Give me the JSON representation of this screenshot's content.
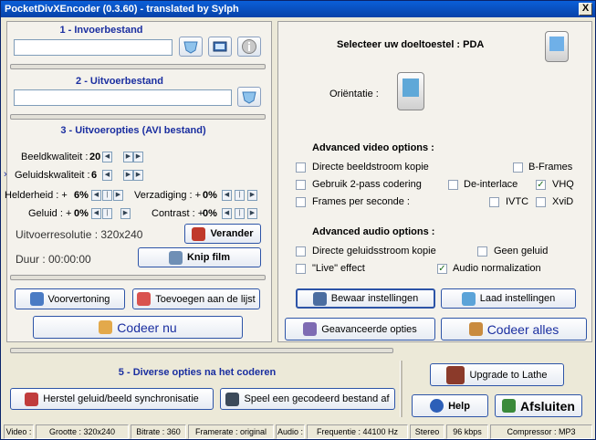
{
  "window": {
    "title": "PocketDivXEncoder (0.3.60) - translated by Sylph",
    "close_glyph": "X"
  },
  "sections": {
    "input": "1 - Invoerbestand",
    "output": "2 - Uitvoerbestand",
    "options": "3 - Uitvoeropties (AVI bestand)",
    "misc": "5 - Diverse opties na het coderen"
  },
  "quality": {
    "image_label": "Beeldkwaliteit :",
    "image_value": "20",
    "sound_label": "Geluidskwaliteit :",
    "sound_value": "6",
    "brightness_label": "Helderheid : +",
    "brightness_value": "6%",
    "saturation_label": "Verzadiging : +",
    "saturation_value": "0%",
    "volume_label": "Geluid : +",
    "volume_value": "0%",
    "contrast_label": "Contrast : +",
    "contrast_value": "0%"
  },
  "resolution": {
    "label": "Uitvoerresolutie : 320x240",
    "change_button": "Verander"
  },
  "duration": {
    "label": "Duur : 00:00:00",
    "cut_button": "Knip film"
  },
  "buttons": {
    "preview": "Voorvertoning",
    "add_list": "Toevoegen aan de lijst",
    "encode_now": "Codeer nu",
    "save_settings": "Bewaar instellingen",
    "load_settings": "Laad instellingen",
    "advanced": "Geavanceerde opties",
    "encode_all": "Codeer alles",
    "repair_sync": "Herstel geluid/beeld synchronisatie",
    "play_encoded": "Speel een gecodeerd bestand af",
    "upgrade": "Upgrade to Lathe",
    "help": "Help",
    "close": "Afsluiten"
  },
  "device": {
    "select_label": "Selecteer uw doeltoestel : PDA",
    "orientation_label": "Oriëntatie :"
  },
  "video_options": {
    "title": "Advanced video options :",
    "direct_stream": "Directe beeldstroom kopie",
    "bframes": "B-Frames",
    "two_pass": "Gebruik 2-pass codering",
    "deinterlace": "De-interlace",
    "vhq": "VHQ",
    "fps": "Frames per seconde :",
    "ivtc": "IVTC",
    "xvid": "XviD"
  },
  "audio_options": {
    "title": "Advanced audio options :",
    "direct_sound": "Directe geluidsstroom kopie",
    "no_sound": "Geen geluid",
    "live": "\"Live\" effect",
    "normalization": "Audio normalization"
  },
  "checkbox_states": {
    "vhq": true,
    "normalization": true
  },
  "statusbar": {
    "video": "Video :",
    "size": "Grootte : 320x240",
    "bitrate": "Bitrate : 360",
    "framerate": "Framerate : original",
    "audio": "Audio :",
    "frequency": "Frequentie : 44100 Hz",
    "stereo": "Stereo",
    "kbps": "96 kbps",
    "compressor": "Compressor : MP3"
  },
  "colors": {
    "section_title": "#1a2ea0",
    "title_bar": "#0a5fd8"
  }
}
